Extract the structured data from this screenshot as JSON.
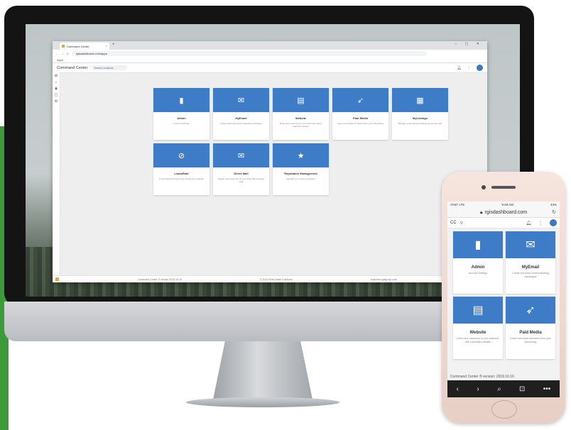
{
  "desktop": {
    "browser": {
      "tab_title": "Command Center",
      "new_tab": "+",
      "window_controls": "–  ▢  ✕",
      "nav_back": "←",
      "nav_forward": "→",
      "nav_reload": "C",
      "url": "rgisdashboard.com/apps",
      "bookmarks": "Apps"
    },
    "app": {
      "title": "Command Center",
      "location_placeholder": "Search Locations",
      "bell_icon": "bell-icon",
      "more_icon": "more-icon",
      "avatar": "user"
    },
    "sidebar": [
      "⊞",
      "⌂",
      "♟",
      "▢",
      "⚙"
    ],
    "cards": [
      {
        "icon": "▮",
        "title": "Admin",
        "desc": "Account Settings"
      },
      {
        "icon": "✉",
        "title": "MyEmail",
        "desc": "Create and track email marketing campaigns"
      },
      {
        "icon": "▤",
        "title": "Website",
        "desc": "Drive new customers to your business with a beautiful website"
      },
      {
        "icon": "➶",
        "title": "Paid Media",
        "desc": "Learn how leads increased from your advertising"
      },
      {
        "icon": "▦",
        "title": "MyListings",
        "desc": "Manage your business listings across the web"
      },
      {
        "icon": "⊘",
        "title": "LeadsRadi",
        "desc": "Know which prospects are visiting your website"
      },
      {
        "icon": "✉",
        "title": "Direct Mail",
        "desc": "Reach new customers in your area with targeted mail"
      },
      {
        "icon": "★",
        "title": "Reputation Management",
        "desc": "Manage your online reputation"
      }
    ],
    "footer": {
      "left": "Command Center ® version 2019.10.16",
      "mid": "© 2019 Real Estate Solutions",
      "right": "customer.rgisgroup.com"
    }
  },
  "phone": {
    "status": {
      "carrier": "AT&T LTE",
      "time": "9:48 AM",
      "battery": "43%"
    },
    "url": "rgisdashboard.com",
    "lock_icon": "lock-icon",
    "reload_icon": "reload-icon",
    "header": {
      "brand": "CC",
      "location_icon": "pin-icon"
    },
    "cards": [
      {
        "icon": "▮",
        "title": "Admin",
        "desc": "Account Settings"
      },
      {
        "icon": "✉",
        "title": "MyEmail",
        "desc": "Create and track email marketing campaigns"
      },
      {
        "icon": "▤",
        "title": "Website",
        "desc": "Drive new customers to your business with a beautiful website"
      },
      {
        "icon": "➶",
        "title": "Paid Media",
        "desc": "Learn how leads increased from your advertising"
      }
    ],
    "footer": "Command Center ® version: 2019.10.16",
    "toolbar": [
      "‹",
      "›",
      "⌕",
      "⊡",
      "•••"
    ]
  }
}
